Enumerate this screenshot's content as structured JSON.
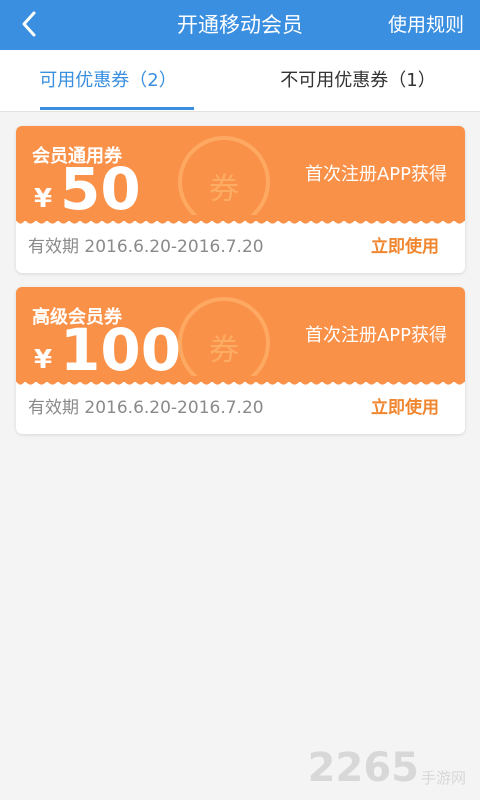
{
  "header": {
    "title": "开通移动会员",
    "rules_label": "使用规则",
    "back_icon": "chevron-left-icon",
    "bg_color": "#3a8fe0"
  },
  "tabs": [
    {
      "label": "可用优惠券（2）",
      "active": true
    },
    {
      "label": "不可用优惠券（1）",
      "active": false
    }
  ],
  "coupons": [
    {
      "name": "会员通用券",
      "currency": "¥",
      "amount": "50",
      "source": "首次注册APP获得",
      "stamp": "券",
      "validity": "有效期  2016.6.20-2016.7.20",
      "action": "立即使用"
    },
    {
      "name": "高级会员券",
      "currency": "¥",
      "amount": "100",
      "source": "首次注册APP获得",
      "stamp": "券",
      "validity": "有效期  2016.6.20-2016.7.20",
      "action": "立即使用"
    }
  ],
  "colors": {
    "accent": "#3a8fe0",
    "coupon": "#fa9148",
    "action": "#f0862f"
  },
  "watermark": {
    "number": "2265",
    "suffix": "手游网"
  }
}
